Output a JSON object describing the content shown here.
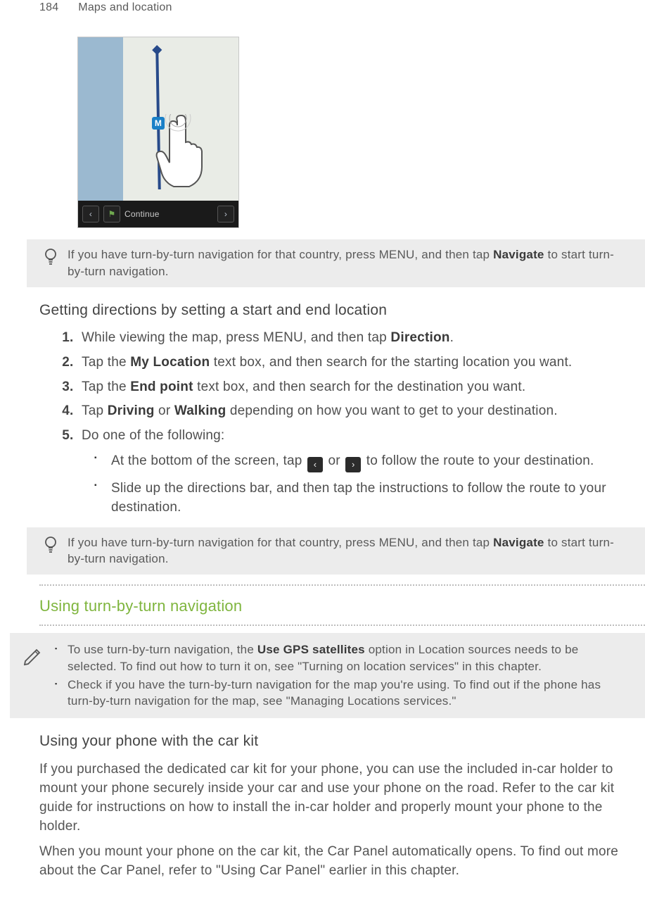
{
  "header": {
    "page_number": "184",
    "chapter_title": "Maps and location"
  },
  "figure": {
    "marker_label": "M",
    "bar_text": "Continue",
    "prev_glyph": "‹",
    "next_glyph": "›",
    "flag_glyph": "⚑"
  },
  "tip1": {
    "pre": "If you have turn-by-turn navigation for that country, press MENU, and then tap ",
    "bold": "Navigate",
    "post": " to start turn-by-turn navigation."
  },
  "headings": {
    "h1": "Getting directions by setting a start and end location",
    "h2": "Using turn-by-turn navigation",
    "h3": "Using your phone with the car kit"
  },
  "steps": {
    "s1": {
      "pre": "While viewing the map, press MENU, and then tap ",
      "bold": "Direction",
      "post": "."
    },
    "s2": {
      "pre": "Tap the ",
      "bold": "My Location",
      "post": " text box, and then search for the starting location you want."
    },
    "s3": {
      "pre": "Tap the ",
      "bold": "End point",
      "post": " text box, and then search for the destination you want."
    },
    "s4": {
      "pre": "Tap ",
      "bold1": "Driving",
      "mid": " or ",
      "bold2": "Walking",
      "post": " depending on how you want to get to your destination."
    },
    "s5": {
      "text": "Do one of the following:"
    },
    "sub1": {
      "pre": "At the bottom of the screen, tap ",
      "mid": " or ",
      "post": " to follow the route to your destination."
    },
    "sub2": {
      "text": "Slide up the directions bar, and then tap the instructions to follow the route to your destination."
    }
  },
  "tip2": {
    "pre": "If you have turn-by-turn navigation for that country, press MENU, and then tap ",
    "bold": "Navigate",
    "post": " to start turn-by-turn navigation."
  },
  "note": {
    "b1": {
      "pre": "To use turn-by-turn navigation, the ",
      "bold": "Use GPS satellites",
      "post": " option in Location sources needs to be selected. To find out how to turn it on, see \"Turning on location services\" in this chapter."
    },
    "b2": {
      "text": "Check if you have the turn-by-turn navigation for the map you're using. To find out if the phone has turn-by-turn navigation for the map, see \"Managing Locations services.\""
    }
  },
  "paras": {
    "p1": "If you purchased the dedicated car kit for your phone, you can use the included in-car holder to mount your phone securely inside your car and use your phone on the road. Refer to the car kit guide for instructions on how to install the in-car holder and properly mount your phone to the holder.",
    "p2": "When you mount your phone on the car kit, the Car Panel automatically opens. To find out more about the Car Panel, refer to \"Using Car Panel\" earlier in this chapter."
  },
  "icons": {
    "left_glyph": "‹",
    "right_glyph": "›"
  }
}
